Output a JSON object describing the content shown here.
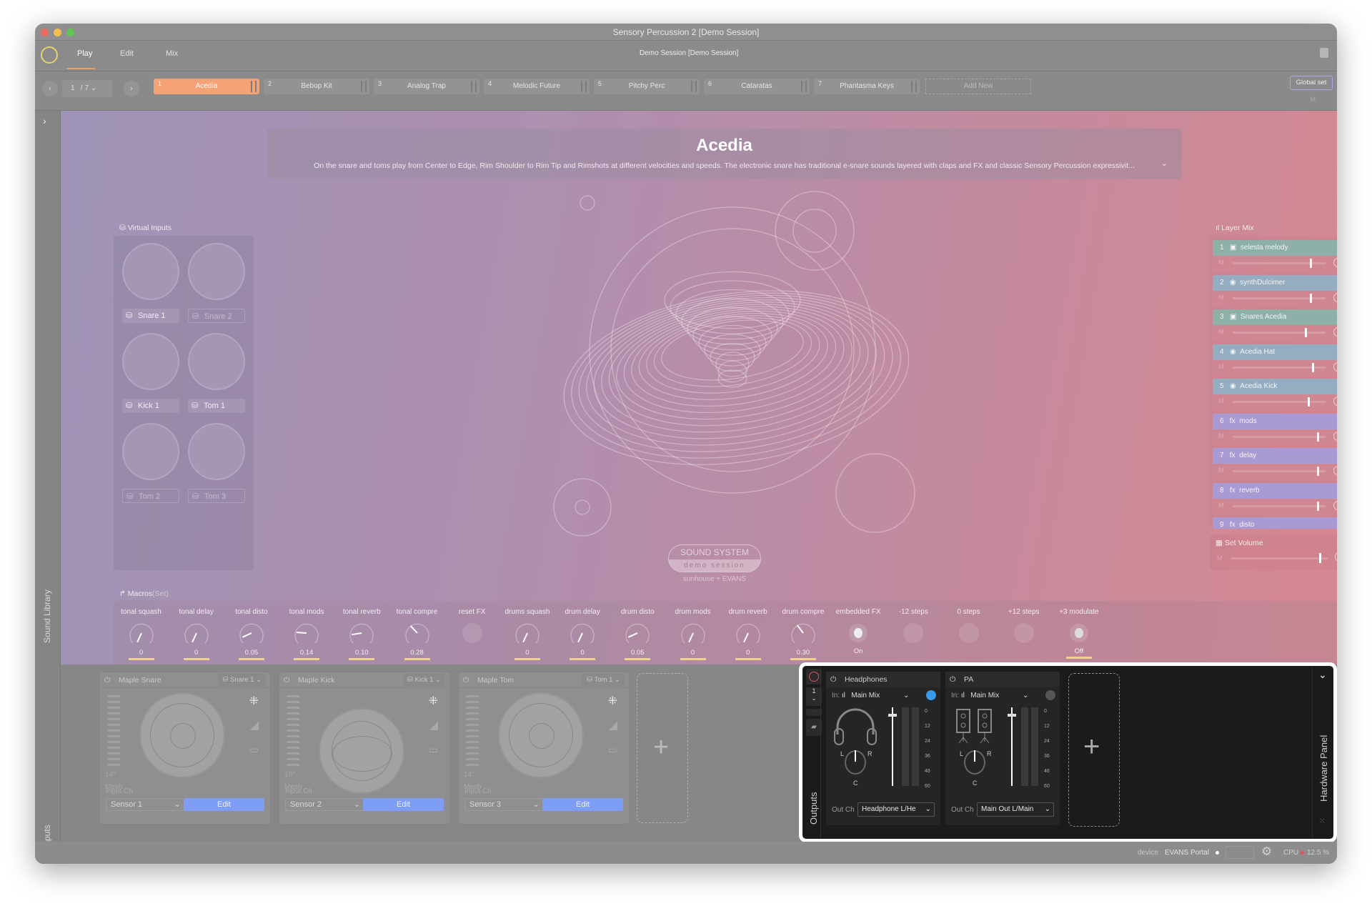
{
  "window": {
    "title": "Sensory Percussion 2 [Demo Session]"
  },
  "menu": {
    "tabs": [
      "Play",
      "Edit",
      "Mix"
    ],
    "active_tab": "Play",
    "session_name": "Demo Session",
    "session_bracket": "[Demo Session]"
  },
  "kitbar": {
    "page": "1",
    "page_total": "/ 7",
    "kits": [
      {
        "num": "1",
        "name": "Acedia",
        "active": true
      },
      {
        "num": "2",
        "name": "Bebop Kit"
      },
      {
        "num": "3",
        "name": "Analog Trap"
      },
      {
        "num": "4",
        "name": "Melodic Future"
      },
      {
        "num": "5",
        "name": "Pitchy Perc"
      },
      {
        "num": "6",
        "name": "Cataratas"
      },
      {
        "num": "7",
        "name": "Phantasma Keys"
      }
    ],
    "add_new": "Add New",
    "global_set": "Global set",
    "m_label": "M"
  },
  "sidebar": {
    "sound_library": "Sound Library"
  },
  "kit_header": {
    "title": "Acedia",
    "description": "On the snare and toms play from Center to Edge, Rim Shoulder to Rim Tip and Rimshots at different velocities and speeds. The electronic snare has traditional e-snare sounds layered with claps and FX and classic Sensory Percussion expressivit..."
  },
  "virtual_inputs": {
    "title": "Virtual Inputs",
    "items": [
      {
        "label": "Snare 1",
        "active": true,
        "icon": "snare-drum-icon"
      },
      {
        "label": "Snare 2",
        "active": false,
        "icon": "snare-drum-icon"
      },
      {
        "label": "Kick 1",
        "active": true,
        "icon": "kick-drum-icon"
      },
      {
        "label": "Tom 1",
        "active": true,
        "icon": "tom-drum-icon"
      },
      {
        "label": "Tom 2",
        "active": false,
        "icon": "tom-drum-icon"
      },
      {
        "label": "Tom 3",
        "active": false,
        "icon": "tom-drum-icon"
      }
    ]
  },
  "logo": {
    "line1": "SOUND SYSTEM",
    "line2": "demo session",
    "line3": "sunhouse + EVANS"
  },
  "layer_mix": {
    "title": "Layer Mix",
    "mute_label": "M",
    "layers": [
      {
        "num": "1",
        "icon": "sampler-icon",
        "name": "selesta melody",
        "color": "#8fb0a8",
        "level": 0.83
      },
      {
        "num": "2",
        "icon": "synth-icon",
        "name": "synthDulcimer",
        "color": "#94adc0",
        "level": 0.83
      },
      {
        "num": "3",
        "icon": "sampler-icon",
        "name": "Snares Acedia",
        "color": "#8fb0a8",
        "level": 0.78
      },
      {
        "num": "4",
        "icon": "synth-icon",
        "name": "Acedia Hat",
        "color": "#94adc0",
        "level": 0.85
      },
      {
        "num": "5",
        "icon": "synth-icon",
        "name": "Acedia Kick",
        "color": "#94adc0",
        "level": 0.81
      },
      {
        "num": "6",
        "icon": "fx-icon",
        "name": "mods",
        "color": "#a99ad4",
        "level": 0.91
      },
      {
        "num": "7",
        "icon": "fx-icon",
        "name": "delay",
        "color": "#a99ad4",
        "level": 0.91
      },
      {
        "num": "8",
        "icon": "fx-icon",
        "name": "reverb",
        "color": "#a99ad4",
        "level": 0.91
      },
      {
        "num": "9",
        "icon": "fx-icon",
        "name": "disto",
        "color": "#a99ad4",
        "level": 0.91
      }
    ],
    "fx_glyph": "fx",
    "set_volume": {
      "title": "Set Volume",
      "level": 0.91
    }
  },
  "macros": {
    "title": "Macros",
    "title_suffix": "(Set)",
    "items": [
      {
        "label": "tonal squash",
        "type": "knob",
        "value": "0"
      },
      {
        "label": "tonal delay",
        "type": "knob",
        "value": "0"
      },
      {
        "label": "tonal disto",
        "type": "knob",
        "value": "0.05"
      },
      {
        "label": "tonal mods",
        "type": "knob",
        "value": "0.14"
      },
      {
        "label": "tonal reverb",
        "type": "knob",
        "value": "0.10"
      },
      {
        "label": "tonal compre",
        "type": "knob",
        "value": "0.28"
      },
      {
        "label": "reset FX",
        "type": "button",
        "value": ""
      },
      {
        "label": "drums squash",
        "type": "knob",
        "value": "0"
      },
      {
        "label": "drum delay",
        "type": "knob",
        "value": "0"
      },
      {
        "label": "drum disto",
        "type": "knob",
        "value": "0.05"
      },
      {
        "label": "drum mods",
        "type": "knob",
        "value": "0"
      },
      {
        "label": "drum reverb",
        "type": "knob",
        "value": "0"
      },
      {
        "label": "drum compre",
        "type": "knob",
        "value": "0.30"
      },
      {
        "label": "embedded FX",
        "type": "toggle",
        "value": "On"
      },
      {
        "label": "-12 steps",
        "type": "button",
        "value": ""
      },
      {
        "label": "0 steps",
        "type": "button",
        "value": ""
      },
      {
        "label": "+12 steps",
        "type": "button",
        "value": ""
      },
      {
        "label": "+3 modulate",
        "type": "toggle",
        "value": "Off"
      }
    ]
  },
  "inputs": {
    "title": "Inputs",
    "cards": [
      {
        "name": "Maple Snare",
        "type": "Snare",
        "num": "1",
        "size": "14\"",
        "head": "Mesh",
        "input_ch_label": "Input Ch",
        "sensor": "Sensor 1",
        "edit": "Edit"
      },
      {
        "name": "Maple Kick",
        "type": "Kick",
        "num": "1",
        "size": "18\"",
        "head": "Mesh",
        "input_ch_label": "Input Ch",
        "sensor": "Sensor 2",
        "edit": "Edit"
      },
      {
        "name": "Maple Tom",
        "type": "Tom",
        "num": "1",
        "size": "14\"",
        "head": "Mesh",
        "input_ch_label": "Input Ch",
        "sensor": "Sensor 3",
        "edit": "Edit"
      }
    ]
  },
  "outputs": {
    "title": "Outputs",
    "page": "1",
    "cards": [
      {
        "name": "Headphones",
        "in_label": "In:",
        "in_source": "Main Mix",
        "out_label": "Out Ch",
        "out_ch": "Headphone L/He",
        "monitor_active": true,
        "fader": 0.92
      },
      {
        "name": "PA",
        "in_label": "In:",
        "in_source": "Main Mix",
        "out_label": "Out Ch",
        "out_ch": "Main Out L/Main",
        "monitor_active": false,
        "fader": 0.92
      }
    ],
    "meter_scale": [
      "0",
      "12",
      "24",
      "36",
      "48",
      "60"
    ],
    "pan": {
      "l": "L",
      "r": "R",
      "c": "C"
    },
    "hardware_panel": "Hardware Panel",
    "accent": "#3a9be8"
  },
  "status": {
    "device_label": "device",
    "device": "EVANS Portal",
    "cpu_label": "CPU",
    "cpu": "12.5 %"
  }
}
